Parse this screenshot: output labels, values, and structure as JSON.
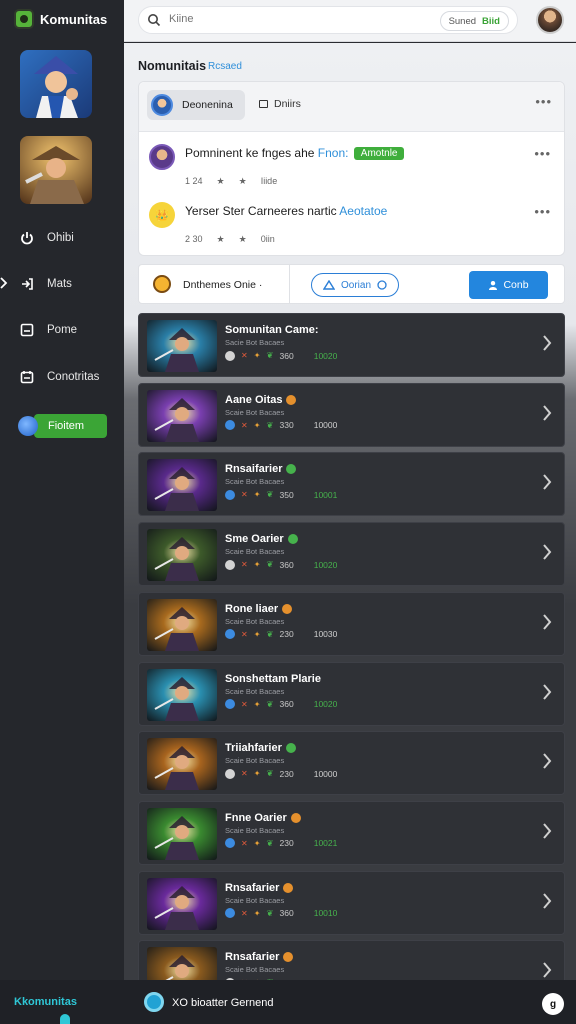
{
  "app": {
    "brand": "Komunitas"
  },
  "sidebar": {
    "games": [
      {
        "name": "game-thumb-1"
      },
      {
        "name": "game-thumb-2"
      }
    ],
    "items": [
      {
        "label": "Ohibi",
        "icon": "power-icon"
      },
      {
        "label": "Mats",
        "icon": "arrow-right-icon"
      },
      {
        "label": "Pome",
        "icon": "inbox-icon"
      },
      {
        "label": "Conotritas",
        "icon": "calendar-icon"
      }
    ],
    "active_item": {
      "label": "Fioitem",
      "icon": "globe-icon"
    }
  },
  "topbar": {
    "search_placeholder": "Kiine",
    "pill_text": "Suned",
    "pill_accent": "Biid"
  },
  "main": {
    "title": "Nomunitais",
    "subtitle": "Rcsaed",
    "card": {
      "tab_active": "Deonenina",
      "tab_other": "Dniirs",
      "feed": [
        {
          "text": "Pomninent ke fnges ahe",
          "highlight": "Fnon:",
          "badge": "Amotnle",
          "meta_a": "1 24",
          "meta_b": "Iiide"
        },
        {
          "text": "Yerser Ster Carneeres nartic",
          "highlight": "Aeotatoe",
          "badge": "",
          "meta_a": "2 30",
          "meta_b": "0iin"
        }
      ]
    },
    "filter": {
      "label": "Dnthemes Onie ·",
      "pill": "Oorian",
      "button": "Conb"
    },
    "games": [
      {
        "title": "Somunitan Came:",
        "sub": "Sacie Bot Bacaes",
        "n1": "360",
        "n2": "10020",
        "n2color": "#46b24c",
        "dot": "",
        "thumb": "#2a7fa8"
      },
      {
        "title": "Aane Oitas",
        "sub": "Scaie Bot Bacaes",
        "n1": "330",
        "n2": "10000",
        "n2color": "#cfcfcf",
        "dot": "#e5902d",
        "thumb": "#7a3fb0"
      },
      {
        "title": "Rnsaifarier",
        "sub": "Scaie Bot Bacaes",
        "n1": "350",
        "n2": "10001",
        "n2color": "#46b24c",
        "dot": "#46b24c",
        "thumb": "#5a2a8c"
      },
      {
        "title": "Sme Oarier",
        "sub": "Scaie Bot Bacaes",
        "n1": "360",
        "n2": "10020",
        "n2color": "#46b24c",
        "dot": "#46b24c",
        "thumb": "#3d5a2a"
      },
      {
        "title": "Rone liaer",
        "sub": "Scaie Bot Bacaes",
        "n1": "230",
        "n2": "10030",
        "n2color": "#cfcfcf",
        "dot": "#e5902d",
        "thumb": "#a86a1e"
      },
      {
        "title": "Sonshettam Plarie",
        "sub": "Scaie Bot Bacaes",
        "n1": "360",
        "n2": "10020",
        "n2color": "#46b24c",
        "dot": "",
        "thumb": "#2a8fb0"
      },
      {
        "title": "Triiahfarier",
        "sub": "Scaie Bot Bacaes",
        "n1": "230",
        "n2": "10000",
        "n2color": "#cfcfcf",
        "dot": "#46b24c",
        "thumb": "#a8641e"
      },
      {
        "title": "Fnne Oarier",
        "sub": "Scaie Bot Bacaes",
        "n1": "230",
        "n2": "10021",
        "n2color": "#46b24c",
        "dot": "#e5902d",
        "thumb": "#3a8a30"
      },
      {
        "title": "Rnsafarier",
        "sub": "Scaie Bot Bacaes",
        "n1": "360",
        "n2": "10010",
        "n2color": "#46b24c",
        "dot": "#e5902d",
        "thumb": "#6a2a9c"
      },
      {
        "title": "Rnsafarier",
        "sub": "Scaie Bot Bacaes",
        "n1": "",
        "n2": "",
        "n2color": "#cfcfcf",
        "dot": "#e5902d",
        "thumb": "#8a5a1e"
      }
    ]
  },
  "bottombar": {
    "brand": "Kkomunitas",
    "text": "XO bioatter Gernend",
    "help": "g"
  }
}
